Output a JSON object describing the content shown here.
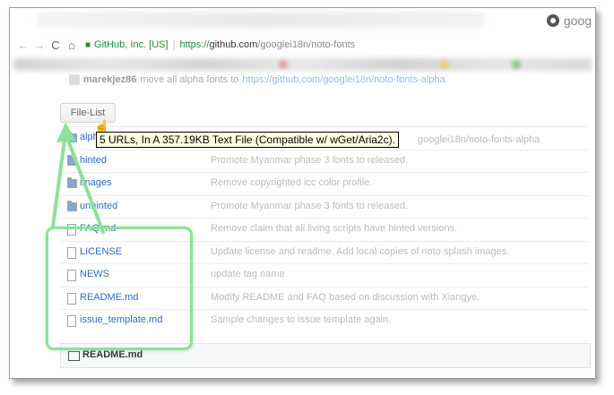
{
  "browser": {
    "tab_title": "goog",
    "secure_label": "GitHub, Inc. [US]",
    "url_scheme": "https://",
    "url_host": "github.com",
    "url_path": "/googlei18n/noto-fonts",
    "nav": {
      "back": "←",
      "forward": "→",
      "reload": "C",
      "home": "⌂"
    }
  },
  "commit": {
    "author": "marekjez86",
    "message": "move all alpha fonts to",
    "link": "https://github.com/googlei18n/noto-fonts-alpha"
  },
  "file_list_button": "File-List",
  "tooltip": "5 URLs, In A 357.19KB Text File (Compatible w/ wGet/Aria2c).",
  "tooltip_tail": "googlei18n/noto-fonts-alpha",
  "files": [
    {
      "name": "alpha",
      "type": "folder",
      "message": ""
    },
    {
      "name": "hinted",
      "type": "folder",
      "message": "Promote Myanmar phase 3 fonts to released."
    },
    {
      "name": "images",
      "type": "folder",
      "message": "Remove copyrighted icc color profile."
    },
    {
      "name": "unhinted",
      "type": "folder",
      "message": "Promote Myanmar phase 3 fonts to released."
    },
    {
      "name": "FAQ.md",
      "type": "file",
      "message": "Remove claim that all living scripts have hinted versions."
    },
    {
      "name": "LICENSE",
      "type": "file",
      "message": "Update license and readme. Add local copies of noto splash images."
    },
    {
      "name": "NEWS",
      "type": "file",
      "message": "update tag name"
    },
    {
      "name": "README.md",
      "type": "file",
      "message": "Modify README and FAQ based on discussion with Xiangye."
    },
    {
      "name": "issue_template.md",
      "type": "file",
      "message": "Sample changes to issue template again."
    }
  ],
  "readme_header": "README.md",
  "colors": {
    "highlight": "#8fe09a",
    "link": "#2f6bbf",
    "tooltip_bg": "#ffffe1"
  }
}
